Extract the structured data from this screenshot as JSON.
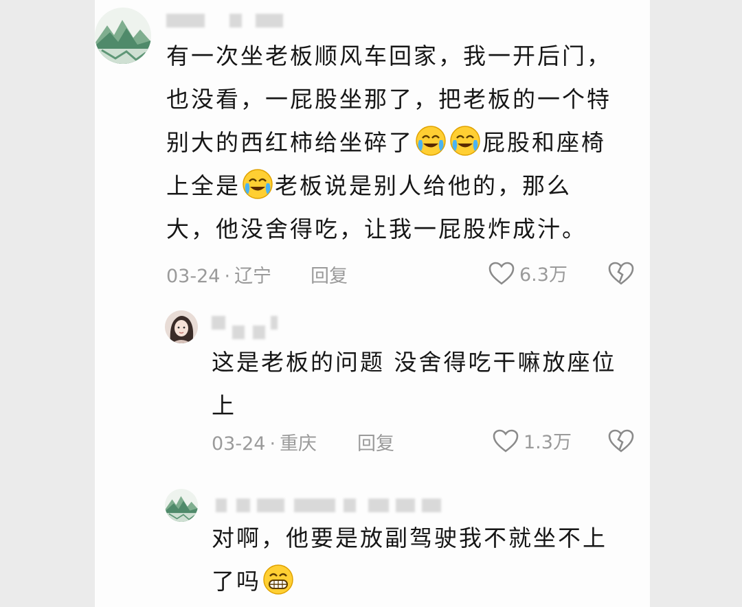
{
  "comments": [
    {
      "text_before_1": "有一次坐老板顺风车回家，我一开后门，也没看，一屁股坐那了，把老板的一个特别大的西红柿给坐碎了",
      "text_mid": "屁股和座椅上全是",
      "text_after": "老板说是别人给他的，那么大，他没舍得吃，让我一屁股炸成汁。",
      "date": "03-24",
      "location": "辽宁",
      "reply_label": "回复",
      "likes": "6.3万",
      "avatar_icon": "landscape-avatar-icon"
    },
    {
      "text": "这是老板的问题 没舍得吃干嘛放座位上",
      "date": "03-24",
      "location": "重庆",
      "reply_label": "回复",
      "likes": "1.3万",
      "avatar_icon": "girl-avatar-icon"
    },
    {
      "text": "对啊，他要是放副驾驶我不就坐不上了吗",
      "avatar_icon": "landscape-avatar-icon"
    }
  ],
  "colors": {
    "text": "#161616",
    "meta": "#9a9a9a",
    "background": "#fdfdfd"
  }
}
